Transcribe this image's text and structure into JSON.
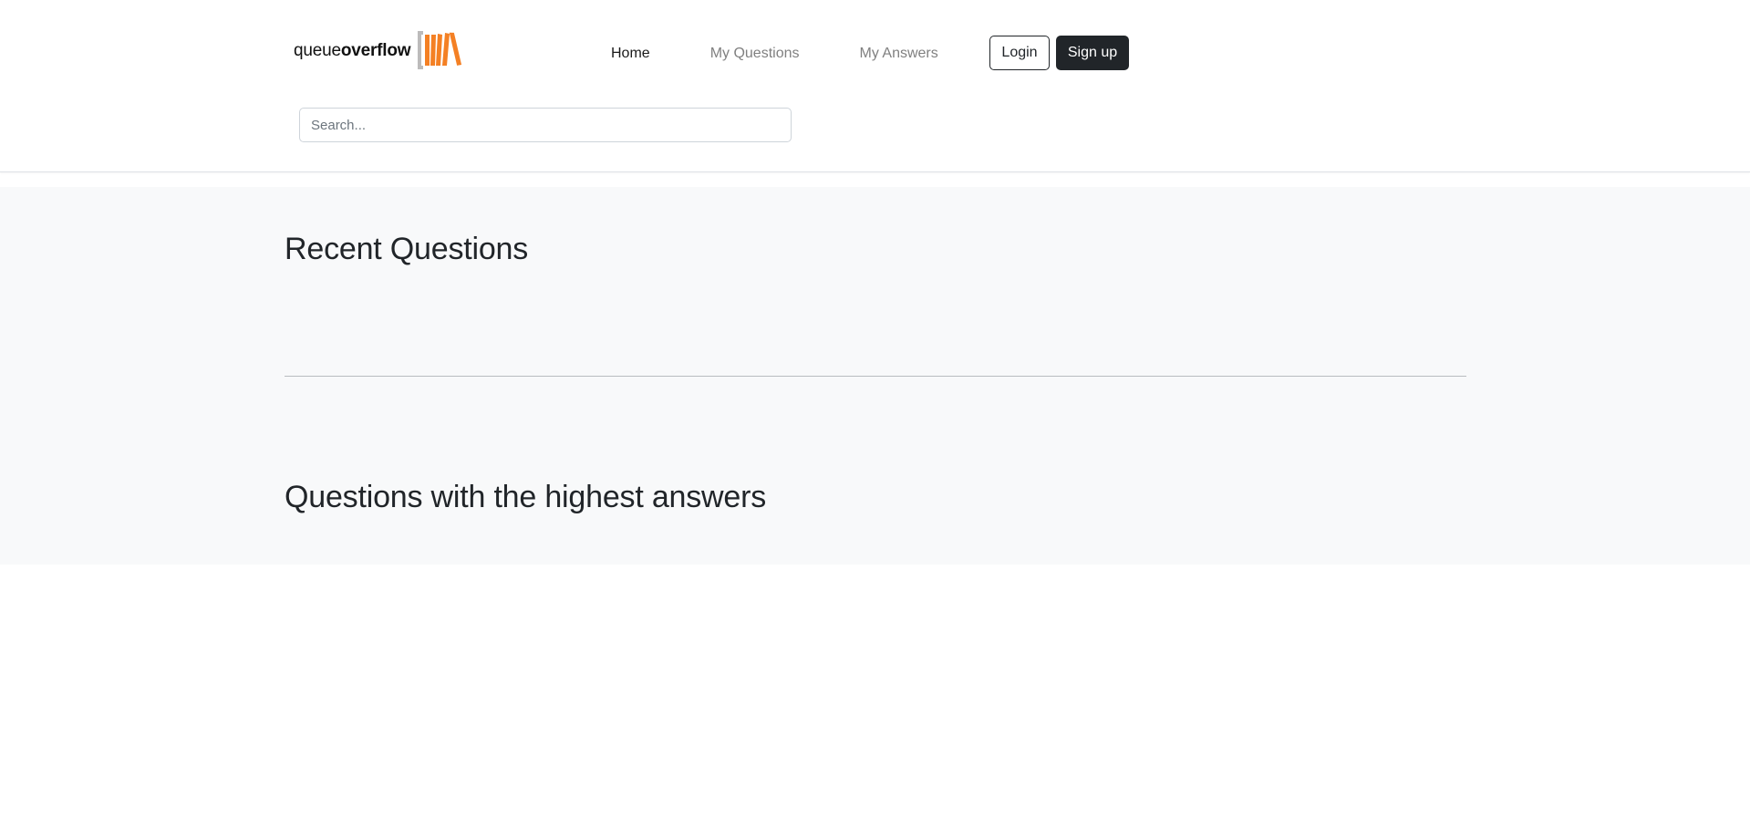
{
  "brand": {
    "name_light": "queue",
    "name_bold": "overflow",
    "logo_icon": "stacked-books-icon",
    "logo_colors": {
      "bracket": "#bcbbbb",
      "bars": "#f48024"
    }
  },
  "nav": {
    "items": [
      {
        "label": "Home",
        "active": true
      },
      {
        "label": "My Questions",
        "active": false
      },
      {
        "label": "My Answers",
        "active": false
      }
    ]
  },
  "auth": {
    "login_label": "Login",
    "signup_label": "Sign up"
  },
  "search": {
    "placeholder": "Search...",
    "value": ""
  },
  "sections": {
    "recent_title": "Recent Questions",
    "highest_title": "Questions with the highest answers"
  },
  "colors": {
    "dark": "#212529",
    "muted_link": "#808080",
    "section_bg": "#f8f9fa"
  }
}
